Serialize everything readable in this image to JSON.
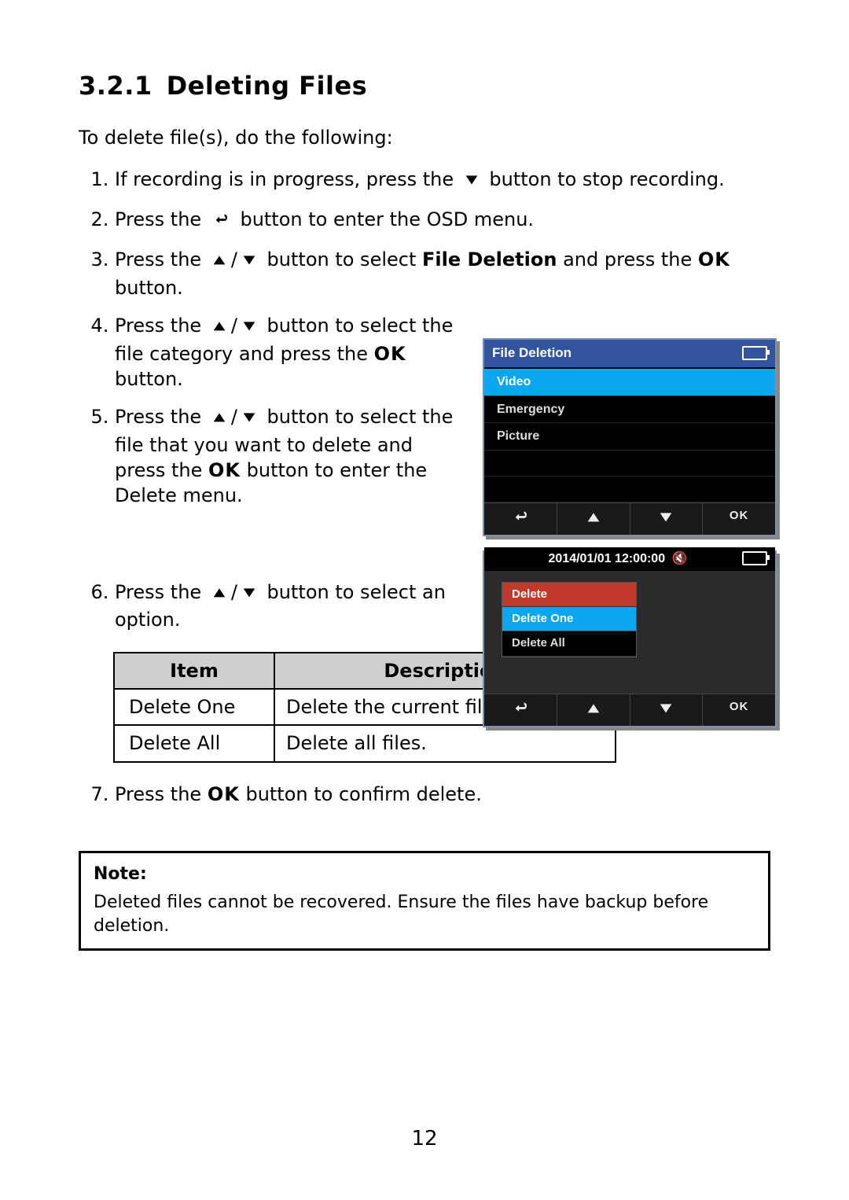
{
  "section": {
    "number": "3.2.1",
    "title": "Deleting Files"
  },
  "intro": "To delete file(s), do the following:",
  "steps": {
    "s1a": "If recording is in progress, press the ",
    "s1b": " button to stop recording.",
    "s2a": "Press the ",
    "s2b": " button to enter the OSD menu.",
    "s3a": "Press the ",
    "s3b": " button to select ",
    "s3bold": "File Deletion",
    "s3c": " and press the ",
    "s3ok": "OK",
    "s3d": " button.",
    "s4a": "Press the ",
    "s4b": " button to select the file category and press the ",
    "s4ok": "OK",
    "s4c": " button.",
    "s5a": "Press the ",
    "s5b": " button to select the file that you want to delete and press the ",
    "s5ok": "OK",
    "s5c": " button to enter the Delete menu.",
    "s6a": "Press the ",
    "s6b": " button to select an option.",
    "s7a": "Press the ",
    "s7ok": "OK",
    "s7b": " button to confirm delete."
  },
  "table": {
    "headers": {
      "item": "Item",
      "desc": "Description"
    },
    "rows": [
      {
        "item": "Delete One",
        "desc": "Delete the current file."
      },
      {
        "item": "Delete All",
        "desc": "Delete all files."
      }
    ]
  },
  "note": {
    "label": "Note:",
    "body": "Deleted files cannot be recovered. Ensure the files have backup before deletion."
  },
  "page_number": "12",
  "osd1": {
    "title": "File Deletion",
    "items": [
      "Video",
      "Emergency",
      "Picture"
    ],
    "nav_ok": "OK"
  },
  "osd2": {
    "timestamp": "2014/01/01 12:00:00",
    "menu_title": "Delete",
    "items": [
      "Delete One",
      "Delete All"
    ],
    "nav_ok": "OK"
  }
}
